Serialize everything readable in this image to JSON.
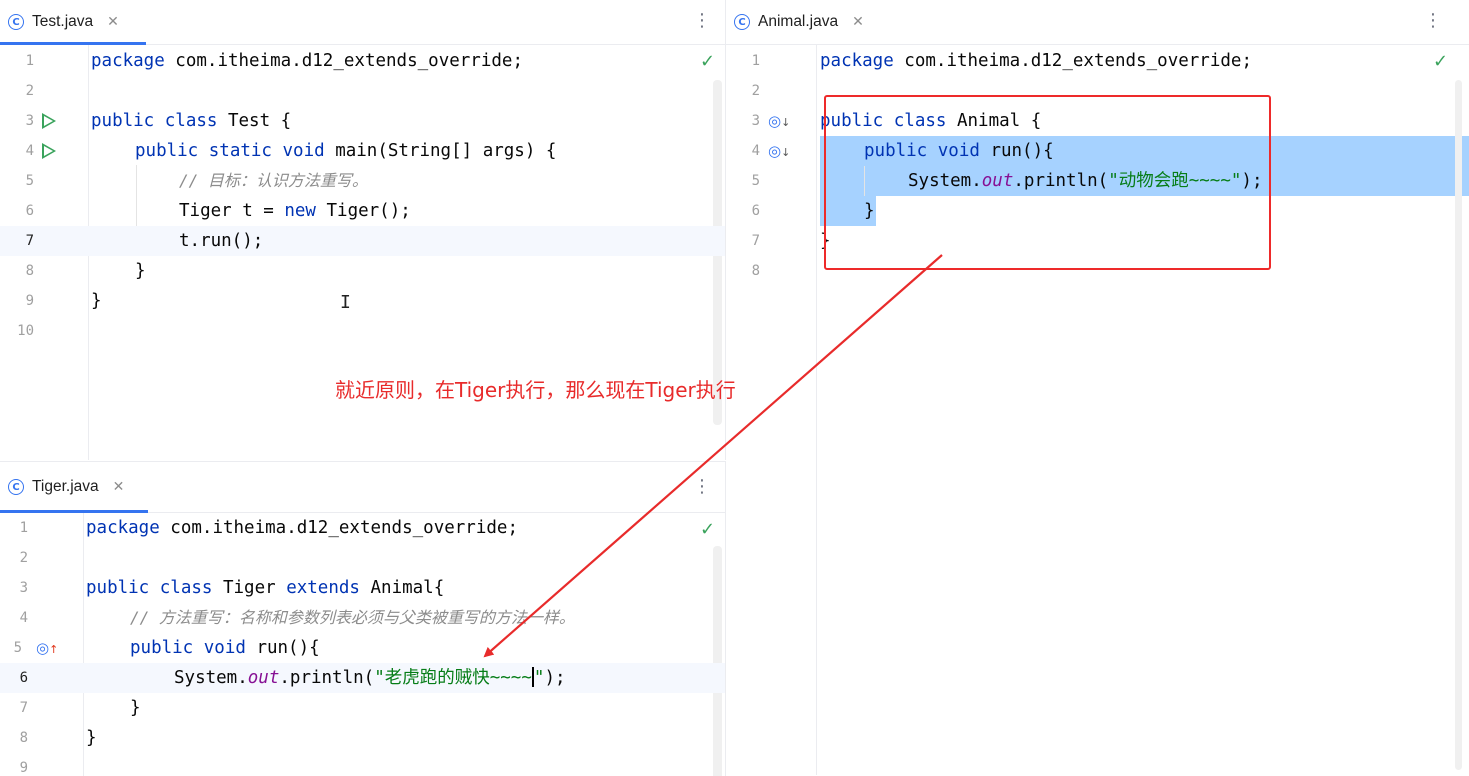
{
  "tabs": {
    "test": {
      "icon_letter": "C",
      "name": "Test.java",
      "close": "✕"
    },
    "animal": {
      "icon_letter": "C",
      "name": "Animal.java",
      "close": "✕"
    },
    "tiger": {
      "icon_letter": "C",
      "name": "Tiger.java",
      "close": "✕"
    }
  },
  "menu_glyph": "⋮",
  "check_glyph": "✓",
  "test_code": {
    "line_numbers": [
      "1",
      "2",
      "3",
      "4",
      "5",
      "6",
      "7",
      "8",
      "9",
      "10"
    ],
    "pkg_kw": "package",
    "pkg_name": " com.itheima.d12_extends_override;",
    "l3_kw": "public class",
    "l3_rest": " Test {",
    "l4_kw": "public static void",
    "l4_rest": " main(String[] args) {",
    "l5_comment": "// 目标：认识方法重写。",
    "l6_a": "Tiger t = ",
    "l6_kw": "new",
    "l6_b": " Tiger();",
    "l7": "t.run();",
    "l8": "}",
    "l9": "}",
    "mouse_cursor": "I"
  },
  "animal_code": {
    "line_numbers": [
      "1",
      "2",
      "3",
      "4",
      "5",
      "6",
      "7",
      "8"
    ],
    "pkg_kw": "package",
    "pkg_name": " com.itheima.d12_extends_override;",
    "l3_kw": "public class",
    "l3_rest": " Animal {",
    "l4_kw": "public void",
    "l4_rest": " run(){",
    "l5_a": "System.",
    "l5_field": "out",
    "l5_b": ".println(",
    "l5_str": "\"动物会跑~~~~\"",
    "l5_c": ");",
    "l6": "}",
    "l7": "}"
  },
  "tiger_code": {
    "line_numbers": [
      "1",
      "2",
      "3",
      "4",
      "5",
      "6",
      "7",
      "8",
      "9"
    ],
    "pkg_kw": "package",
    "pkg_name": " com.itheima.d12_extends_override;",
    "l3_kw": "public class",
    "l3_name": " Tiger ",
    "l3_kw2": "extends",
    "l3_rest": " Animal{",
    "l4_comment": "// 方法重写：名称和参数列表必须与父类被重写的方法一样。",
    "l5_kw": "public void",
    "l5_rest": " run(){",
    "l6_a": "System.",
    "l6_field": "out",
    "l6_b": ".println(",
    "l6_str": "\"老虎跑的贼快~~~~",
    "l6_str_end": "\"",
    "l6_c": ");",
    "l7": "}",
    "l8": "}"
  },
  "annotation_text": "就近原则，在Tiger执行，那么现在Tiger执行",
  "colors": {
    "keyword": "#0033b3",
    "string": "#067d17",
    "field": "#871094",
    "comment": "#8c8c8c",
    "selection": "#a6d2ff",
    "annotation": "#e82b2b",
    "tab_accent": "#3574f0"
  }
}
